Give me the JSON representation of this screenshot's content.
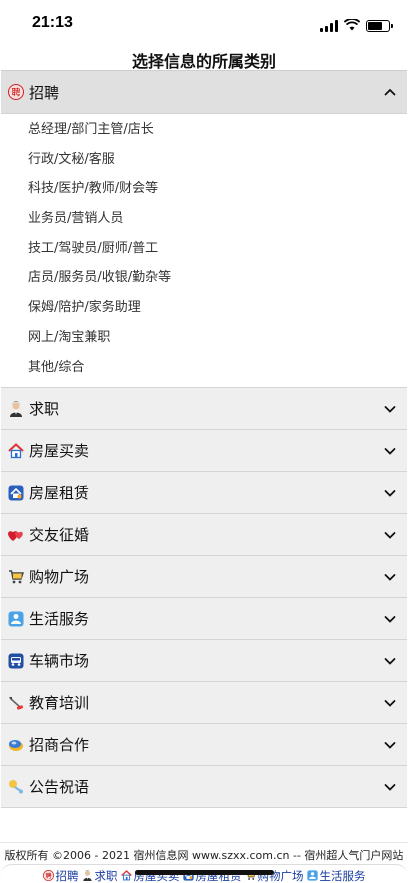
{
  "status_bar": {
    "time": "21:13",
    "battery_level": 0.7
  },
  "page": {
    "title": "选择信息的所属类别"
  },
  "categories": [
    {
      "label": "招聘",
      "icon": "recruit-icon",
      "expanded": true,
      "items": [
        "总经理/部门主管/店长",
        "行政/文秘/客服",
        "科技/医护/教师/财会等",
        "业务员/营销人员",
        "技工/驾驶员/厨师/普工",
        "店员/服务员/收银/勤杂等",
        "保姆/陪护/家务助理",
        "网上/淘宝兼职",
        "其他/综合"
      ]
    },
    {
      "label": "求职",
      "icon": "job-seeker-icon"
    },
    {
      "label": "房屋买卖",
      "icon": "house-icon"
    },
    {
      "label": "房屋租赁",
      "icon": "rent-icon"
    },
    {
      "label": "交友征婚",
      "icon": "hearts-icon"
    },
    {
      "label": "购物广场",
      "icon": "cart-icon"
    },
    {
      "label": "生活服务",
      "icon": "life-service-icon"
    },
    {
      "label": "车辆市场",
      "icon": "car-icon"
    },
    {
      "label": "教育培训",
      "icon": "education-icon"
    },
    {
      "label": "招商合作",
      "icon": "business-icon"
    },
    {
      "label": "公告祝语",
      "icon": "announcement-icon"
    }
  ],
  "footer": {
    "copyright": "版权所有 ©2006 - 2021 宿州信息网 www.szxx.com.cn -- 宿州超人气门户网站",
    "nav": [
      "招聘",
      "求职",
      "房屋买卖",
      "房屋租赁",
      "购物广场",
      "生活服务"
    ]
  },
  "colors": {
    "link": "#1a3ea0",
    "header_bg": "#efefef",
    "open_header_bg": "#e0e0e0"
  }
}
